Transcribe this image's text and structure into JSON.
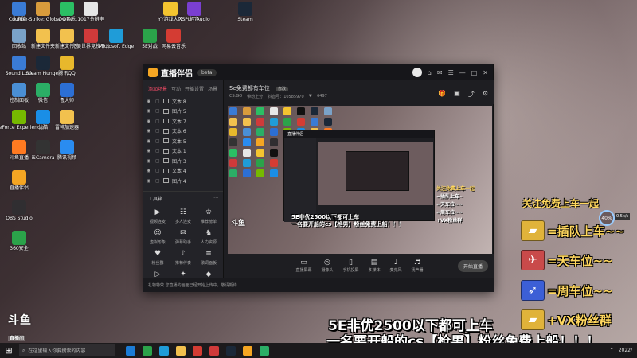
{
  "desktop_icons": [
    {
      "label": "此电脑",
      "icon": "computer-icon",
      "color": "#3a7bd5"
    },
    {
      "label": "Counter-Strike: Global Offe...",
      "icon": "csgo-icon",
      "color": "#d89b3c"
    },
    {
      "label": "QQ音乐",
      "icon": "qqmusic-icon",
      "color": "#2bbf64"
    },
    {
      "label": "1017分辨率",
      "icon": "file-icon",
      "color": "#e6e6e6"
    },
    {
      "label": "YY游戏大厅",
      "icon": "yy-icon",
      "color": "#f4c430"
    },
    {
      "label": "抖音",
      "icon": "douyin-icon",
      "color": "#111111"
    },
    {
      "label": "Steam",
      "icon": "steam-icon",
      "color": "#1b2838"
    },
    {
      "label": "回收站",
      "icon": "recycle-icon",
      "color": "#7aa2c8"
    },
    {
      "label": "新建文件夹",
      "icon": "folder-icon",
      "color": "#f2c14e"
    },
    {
      "label": "新建文件夹",
      "icon": "folder-icon",
      "color": "#f2c14e"
    },
    {
      "label": "完美世界竞技平台",
      "icon": "perfect-icon",
      "color": "#d03a3a"
    },
    {
      "label": "Microsoft Edge",
      "icon": "edge-icon",
      "color": "#1f9cd8"
    },
    {
      "label": "5E对战",
      "icon": "5e-icon",
      "color": "#2ba34a"
    },
    {
      "label": "网易云音乐",
      "icon": "neteasemusic-icon",
      "color": "#d43c33"
    },
    {
      "label": "Sound Lock",
      "icon": "sound-icon",
      "color": "#3a7bd5"
    },
    {
      "label": "Steam Hunger",
      "icon": "steam-icon",
      "color": "#1b2838"
    },
    {
      "label": "腾讯QQ",
      "icon": "qq-icon",
      "color": "#e8b82c"
    },
    {
      "label": "控制面板",
      "icon": "control-icon",
      "color": "#4a8fd5"
    },
    {
      "label": "微信",
      "icon": "wechat-icon",
      "color": "#2bae66"
    },
    {
      "label": "鲁大师",
      "icon": "ludashi-icon",
      "color": "#2c6fd4"
    },
    {
      "label": "GeForce Experience",
      "icon": "nvidia-icon",
      "color": "#76b900"
    },
    {
      "label": "优酷",
      "icon": "youku-icon",
      "color": "#1a8ee6"
    },
    {
      "label": "雷神加速器",
      "icon": "thunder-icon",
      "color": "#f2c14e"
    },
    {
      "label": "斗鱼直播",
      "icon": "douyu-icon",
      "color": "#ff7a21"
    },
    {
      "label": "iSCamera",
      "icon": "camera-icon",
      "color": "#333333"
    },
    {
      "label": "腾讯视频",
      "icon": "tencentvideo-icon",
      "color": "#2a8cf0"
    },
    {
      "label": "直播伴侣",
      "icon": "companion-icon",
      "color": "#f5a623"
    },
    {
      "label": "OBS Studio",
      "icon": "obs-icon",
      "color": "#302e31"
    },
    {
      "label": "360安全",
      "icon": "360-icon",
      "color": "#2ba34a"
    },
    {
      "label": "XSPLIT Audio",
      "icon": "audio-icon",
      "color": "#7a3fd0"
    }
  ],
  "app": {
    "title": "直播伴侣",
    "version": "beta",
    "tabs": [
      "添加场景",
      "互动",
      "开播设置",
      "场景"
    ],
    "scenes": [
      "文本 8",
      "图片 5",
      "文本 7",
      "文本 6",
      "文本 5",
      "文本 1",
      "图片 3",
      "文本 4",
      "图片 4"
    ],
    "tools_title": "工具箱",
    "tools": [
      {
        "label": "视频连麦",
        "icon": "video-call-icon"
      },
      {
        "label": "多人连麦",
        "icon": "multi-call-icon"
      },
      {
        "label": "推荐榜单",
        "icon": "rank-icon"
      },
      {
        "label": "虚拟形象",
        "icon": "avatar-tool-icon"
      },
      {
        "label": "弹幕助手",
        "icon": "danmaku-icon"
      },
      {
        "label": "人力资源",
        "icon": "hr-icon"
      },
      {
        "label": "粉丝群",
        "icon": "fans-icon"
      },
      {
        "label": "推荐伴奏",
        "icon": "music-icon"
      },
      {
        "label": "歌词面板",
        "icon": "lyric-icon"
      },
      {
        "label": "",
        "icon": "play-icon"
      },
      {
        "label": "",
        "icon": "gift-icon"
      },
      {
        "label": "",
        "icon": "game-icon"
      }
    ],
    "bottom_tip": "礼物特效   您直播的画面已经开始上传中，敬请期待",
    "room_title": "5e免费都有车位",
    "room_tag": "修改",
    "room_game": "CS:GO",
    "room_tag2": "带粉上分",
    "room_uid": "抖音号：10585970",
    "room_fans": "6497",
    "controls": [
      {
        "label": "直播屏幕",
        "icon": "screen-icon"
      },
      {
        "label": "摄像头",
        "icon": "camera-ctrl-icon"
      },
      {
        "label": "手机投屏",
        "icon": "phone-icon"
      },
      {
        "label": "多媒体",
        "icon": "media-icon"
      },
      {
        "label": "麦克风",
        "icon": "mic-icon"
      },
      {
        "label": "扬声器",
        "icon": "speaker-icon"
      }
    ],
    "start_label": "开始直播"
  },
  "preview_overlay": {
    "logo": "斗鱼",
    "line1": "5E非优2500以下都可上车",
    "line2": "一名要开船的cs【枪男】粉丝免费上船！！！",
    "side_title": "关注免费上车一起",
    "side_items": [
      "=插队上车~",
      "=天车位~~",
      "=周车位~~",
      "+VX粉丝群"
    ]
  },
  "overlay": {
    "follow_title": "关注免费上车一起",
    "perks": [
      {
        "text": "=插队上车~~",
        "icon": "ticket-icon",
        "color": "#e0b33a"
      },
      {
        "text": "=天车位~~",
        "icon": "plane-icon",
        "color": "#c94a4a"
      },
      {
        "text": "=周车位~~",
        "icon": "rocket-icon",
        "color": "#3c5fd6"
      },
      {
        "text": "+VX粉丝群",
        "icon": "ticket-icon",
        "color": "#e0b33a"
      }
    ],
    "percent": "40%",
    "speed": "0.5k/s",
    "bottom_line1": "5E非优2500以下都可上车",
    "bottom_line2": "一名要开船的cs【枪男】粉丝免费上船！！！"
  },
  "douyu": {
    "logo": "斗鱼",
    "sub": "直播间",
    "room_no": "10585970"
  },
  "taskbar": {
    "search_placeholder": "在这里输入你要搜索的内容",
    "apps": [
      "#1c7cd6",
      "#2ba34a",
      "#1f9cd8",
      "#f2c14e",
      "#d43c33",
      "#d03a3a",
      "#1b2838",
      "#f5a623",
      "#2bae66"
    ],
    "tray": "2022/"
  }
}
